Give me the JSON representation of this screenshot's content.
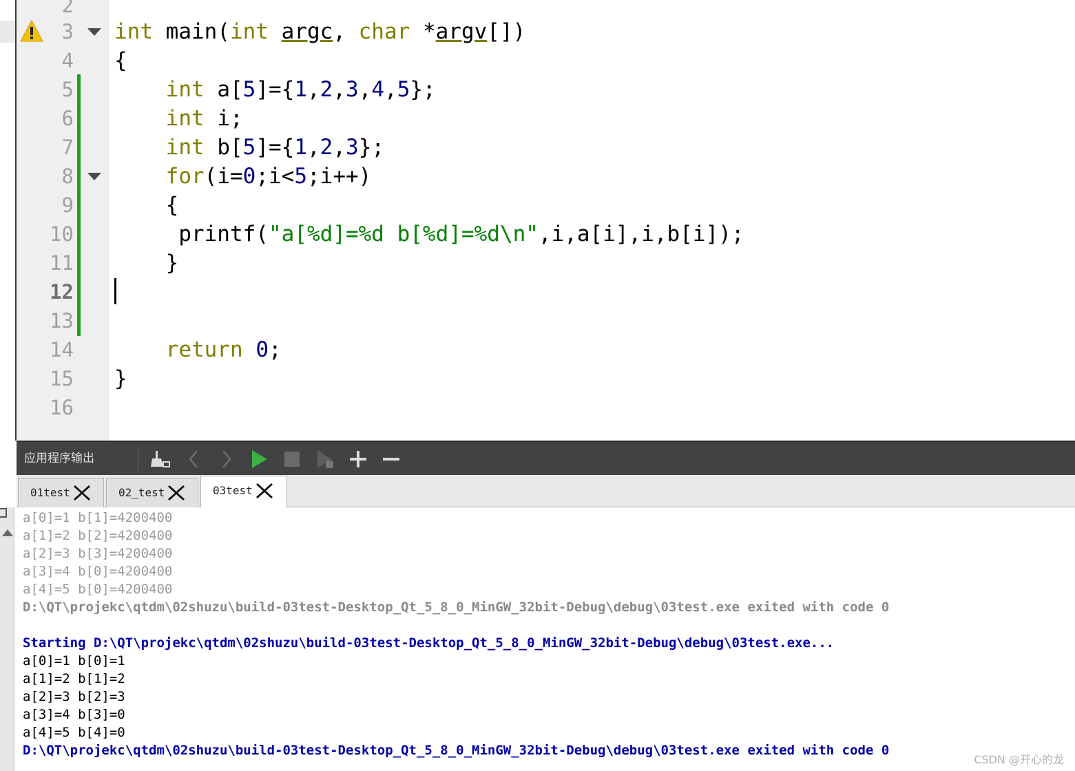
{
  "editor": {
    "line_numbers": [
      "2",
      "3",
      "4",
      "5",
      "6",
      "7",
      "8",
      "9",
      "10",
      "11",
      "12",
      "13",
      "14",
      "15",
      "16"
    ],
    "current_line": "12",
    "code": {
      "l3": {
        "kw1": "int",
        "fn": " main(",
        "kw2": "int",
        "sp": " ",
        "p1": "argc",
        ", ": ", ",
        "kw3": "char",
        "star": " *",
        "p2": "argv",
        "end": "[])"
      },
      "l4": "{",
      "l5": {
        "kw": "int",
        "a": " a[",
        "n5": "5",
        "b": "]={",
        "n1": "1",
        "c1": ",",
        "n2": "2",
        "c2": ",",
        "n3": "3",
        "c3": ",",
        "n4": "4",
        "c4": ",",
        "n5b": "5",
        "end": "};"
      },
      "l6": {
        "kw": "int",
        "rest": " i;"
      },
      "l7": {
        "kw": "int",
        "a": " b[",
        "n5": "5",
        "b": "]={",
        "n1": "1",
        "c1": ",",
        "n2": "2",
        "c2": ",",
        "n3": "3",
        "end": "};"
      },
      "l8": {
        "kw": "for",
        "a": "(i=",
        "n0": "0",
        "b": ";i<",
        "n5": "5",
        "c": ";i++)"
      },
      "l9": "{",
      "l10": {
        "fn": " printf(",
        "str": "\"a[%d]=%d b[%d]=%d\\n\"",
        "rest": ",i,a[i],i,b[i]);"
      },
      "l11": "}",
      "l14": {
        "kw": "return",
        "sp": " ",
        "n0": "0",
        "end": ";"
      },
      "l15": "}"
    }
  },
  "output_pane": {
    "title": "应用程序输出",
    "tabs": [
      {
        "label": "01test"
      },
      {
        "label": "02_test"
      },
      {
        "label": "03test"
      }
    ],
    "lines": [
      {
        "text": "a[0]=1 b[1]=4200400",
        "style": "old"
      },
      {
        "text": "a[1]=2 b[2]=4200400",
        "style": "old"
      },
      {
        "text": "a[2]=3 b[3]=4200400",
        "style": "old"
      },
      {
        "text": "a[3]=4 b[0]=4200400",
        "style": "old"
      },
      {
        "text": "a[4]=5 b[0]=4200400",
        "style": "old"
      },
      {
        "text": "D:\\QT\\projekc\\qtdm\\02shuzu\\build-03test-Desktop_Qt_5_8_0_MinGW_32bit-Debug\\debug\\03test.exe exited with code 0",
        "style": "gray"
      },
      {
        "text": "",
        "style": "norm"
      },
      {
        "text": "Starting D:\\QT\\projekc\\qtdm\\02shuzu\\build-03test-Desktop_Qt_5_8_0_MinGW_32bit-Debug\\debug\\03test.exe...",
        "style": "blue"
      },
      {
        "text": "a[0]=1 b[0]=1",
        "style": "norm"
      },
      {
        "text": "a[1]=2 b[1]=2",
        "style": "norm"
      },
      {
        "text": "a[2]=3 b[2]=3",
        "style": "norm"
      },
      {
        "text": "a[3]=4 b[3]=0",
        "style": "norm"
      },
      {
        "text": "a[4]=5 b[4]=0",
        "style": "norm"
      },
      {
        "text": "D:\\QT\\projekc\\qtdm\\02shuzu\\build-03test-Desktop_Qt_5_8_0_MinGW_32bit-Debug\\debug\\03test.exe exited with code 0",
        "style": "blue"
      }
    ]
  },
  "watermark": "CSDN @开心的龙",
  "colors": {
    "keyword": "#808000",
    "number": "#000080",
    "string": "#008000",
    "toolbar": "#404244",
    "run_green": "#3cb043"
  }
}
